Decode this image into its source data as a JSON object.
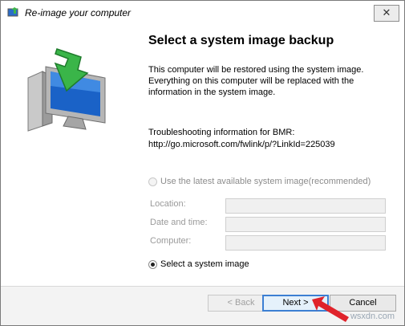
{
  "window": {
    "title": "Re-image your computer",
    "close_glyph": "✕"
  },
  "heading": "Select a system image backup",
  "description": [
    "This computer will be restored using the system image.",
    "Everything on this computer will be replaced with the",
    "information in the system image."
  ],
  "troubleshooting": {
    "line1": "Troubleshooting information for BMR:",
    "line2": "http://go.microsoft.com/fwlink/p/?LinkId=225039"
  },
  "options": {
    "latest": {
      "label": "Use the latest available system image(recommended)",
      "selected": false,
      "enabled": false
    },
    "select": {
      "label": "Select a system image",
      "selected": true,
      "enabled": true
    }
  },
  "fields": [
    {
      "label": "Location:",
      "value": ""
    },
    {
      "label": "Date and time:",
      "value": ""
    },
    {
      "label": "Computer:",
      "value": ""
    }
  ],
  "buttons": {
    "back": "< Back",
    "next": "Next >",
    "cancel": "Cancel"
  },
  "watermark": "wsxdn.com",
  "colors": {
    "accent": "#3c7fd3",
    "arrow": "#e0232b",
    "monitor": "#1a62c7"
  },
  "icons": {
    "title": "system-restore-icon",
    "hero": "monitor-restore-icon"
  }
}
